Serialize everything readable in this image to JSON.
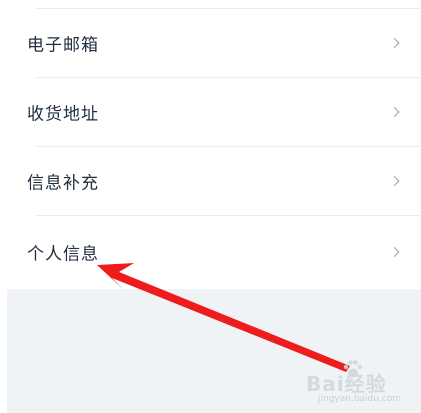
{
  "settings_list": {
    "items": [
      {
        "label": "电子邮箱",
        "icon": "chevron-right-icon"
      },
      {
        "label": "收货地址",
        "icon": "chevron-right-icon"
      },
      {
        "label": "信息补充",
        "icon": "chevron-right-icon"
      },
      {
        "label": "个人信息",
        "icon": "chevron-right-icon"
      }
    ]
  },
  "annotation": {
    "arrow_color": "#ee1c1c",
    "points_to": "个人信息"
  },
  "watermark": {
    "brand": "Bai经验",
    "url": "jingyan.baidu.com"
  },
  "colors": {
    "text": "#1f2d3d",
    "chevron": "#9aa0a6",
    "divider": "#ededed",
    "bottom_background": "#eff3f5"
  }
}
